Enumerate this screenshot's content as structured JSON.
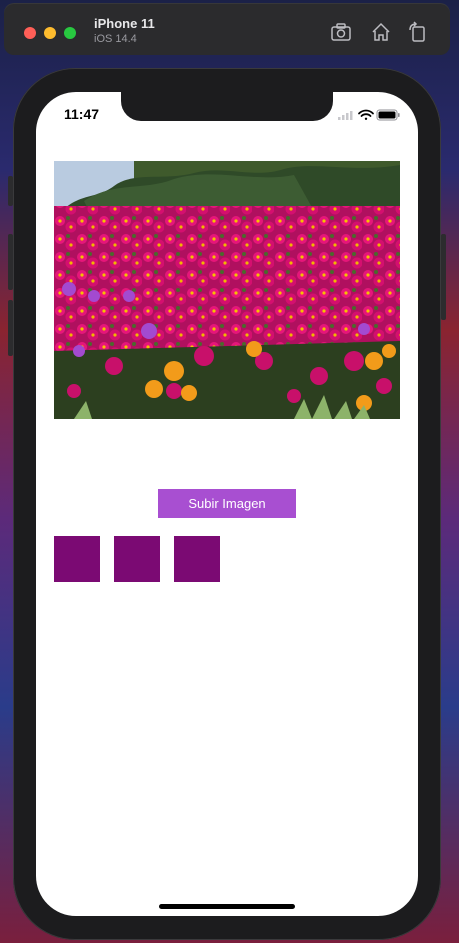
{
  "simulator": {
    "device_name": "iPhone 11",
    "os_version": "iOS 14.4",
    "toolbar_icons": [
      "screenshot-icon",
      "home-icon",
      "rotate-icon"
    ]
  },
  "status_bar": {
    "time": "11:47",
    "icons": [
      "cellular-icon",
      "wifi-icon",
      "battery-icon"
    ]
  },
  "main": {
    "image_description_icon": "photo-flowers",
    "upload_button_label": "Subir Imagen",
    "thumbnails_count": 3
  },
  "colors": {
    "accent": "#a84fd1",
    "thumbnail": "#7b0a73"
  }
}
